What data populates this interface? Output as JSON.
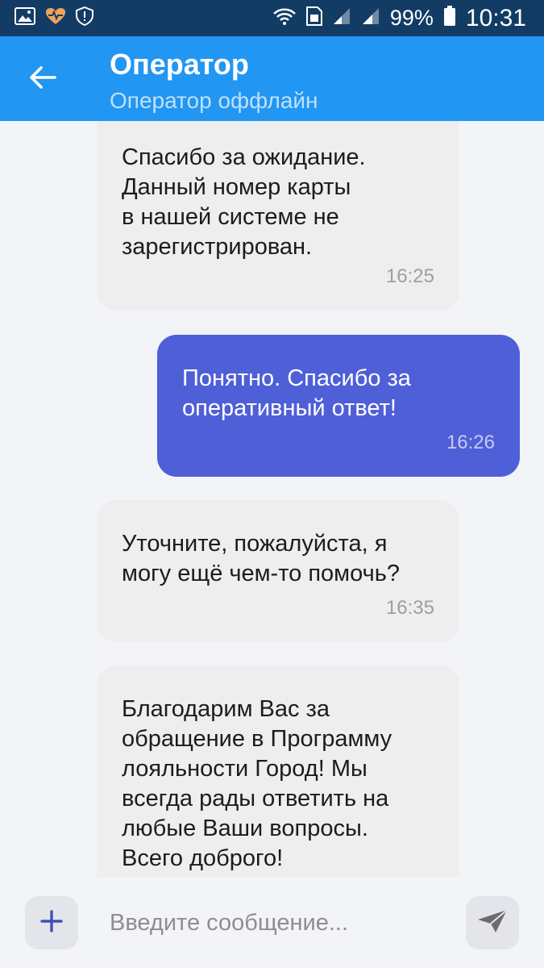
{
  "status_bar": {
    "battery": "99%",
    "time": "10:31",
    "icons": [
      "image-icon",
      "heartbeat-icon",
      "shield-icon",
      "wifi-icon",
      "sim-icon",
      "signal-icon",
      "signal-icon",
      "battery-icon"
    ]
  },
  "header": {
    "title": "Оператор",
    "subtitle": "Оператор оффлайн"
  },
  "messages": [
    {
      "direction": "in",
      "lines": [
        "Спасибо за ожидание.",
        "Данный номер карты",
        "в нашей системе не",
        "зарегистрирован."
      ],
      "time": "16:25"
    },
    {
      "direction": "out",
      "lines": [
        "Понятно. Спасибо за",
        "оперативный ответ!"
      ],
      "time": "16:26"
    },
    {
      "direction": "in",
      "lines": [
        "Уточните, пожалуйста, я",
        "могу ещё чем-то помочь?"
      ],
      "time": "16:35"
    },
    {
      "direction": "in",
      "lines": [
        "Благодарим Вас за",
        "обращение в Программу",
        "лояльности Город! Мы",
        "всегда рады ответить на",
        "любые Ваши вопросы.",
        "Всего доброго!"
      ],
      "time": ""
    }
  ],
  "input": {
    "placeholder": "Введите сообщение..."
  },
  "colors": {
    "status_bar": "#123c63",
    "app_bar": "#2196f3",
    "outgoing_bubble": "#4f5fd8",
    "incoming_bubble": "#eeeeee",
    "accent": "#3f51b5"
  }
}
